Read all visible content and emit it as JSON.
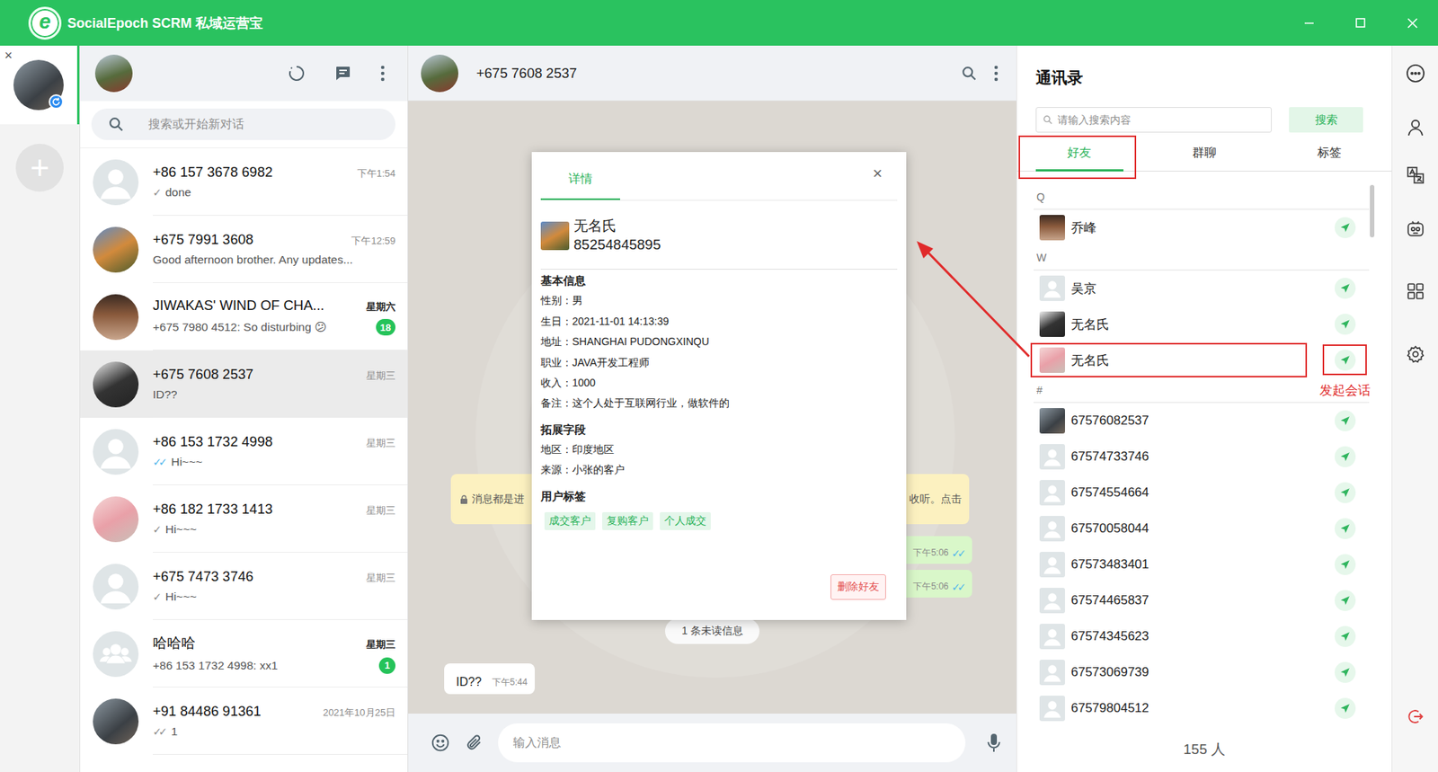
{
  "window": {
    "title": "SocialEpoch SCRM 私域运营宝",
    "logo_letter": "e"
  },
  "accounts": {
    "close": "×",
    "add": "+",
    "items": [
      {
        "selected": true
      }
    ]
  },
  "chat_list": {
    "search_placeholder": "搜索或开始新对话",
    "chats": [
      {
        "name": "+86 157 3678 6982",
        "time": "下午1:54",
        "tick": "✓",
        "tick_read": false,
        "preview": "done",
        "selected": false,
        "avatar": "person"
      },
      {
        "name": "+675 7991 3608",
        "time": "下午12:59",
        "preview": "Good afternoon brother. Any updates...",
        "selected": false,
        "avatar": "photo"
      },
      {
        "name": "JIWAKAS' WIND OF CHA...",
        "time": "星期六",
        "preview": "+675 7980 4512: So disturbing 😕",
        "badge": "18",
        "selected": false,
        "avatar": "photo"
      },
      {
        "name": "+675 7608 2537",
        "time": "星期三",
        "preview": "ID??",
        "selected": true,
        "avatar": "photo"
      },
      {
        "name": "+86 153 1732 4998",
        "time": "星期三",
        "tick": "✓✓",
        "tick_read": true,
        "preview": "Hi~~~",
        "selected": false,
        "avatar": "person"
      },
      {
        "name": "+86 182 1733 1413",
        "time": "星期三",
        "tick": "✓",
        "tick_read": false,
        "preview": "Hi~~~",
        "selected": false,
        "avatar": "photo"
      },
      {
        "name": "+675 7473 3746",
        "time": "星期三",
        "tick": "✓",
        "tick_read": false,
        "preview": "Hi~~~",
        "selected": false,
        "avatar": "person"
      },
      {
        "name": "哈哈哈",
        "time": "星期三",
        "preview": "+86 153 1732 4998: xx1",
        "badge": "1",
        "selected": false,
        "avatar": "group"
      },
      {
        "name": "+91 84486 91361",
        "time": "2021年10月25日",
        "tick": "✓✓",
        "tick_read": false,
        "preview": "1",
        "selected": false,
        "avatar": "photo"
      }
    ]
  },
  "conversation": {
    "name": "+675 7608 2537",
    "input_placeholder": "输入消息",
    "messages": [
      {
        "kind": "system",
        "left": "消息都是进",
        "right": "收听。点击"
      },
      {
        "kind": "out",
        "time": "下午5:06",
        "tick": "✓✓",
        "tick_read": true
      },
      {
        "kind": "out",
        "time": "下午5:06",
        "tick": "✓✓",
        "tick_read": true
      },
      {
        "kind": "unread",
        "text": "1 条未读信息"
      },
      {
        "kind": "in",
        "text": "ID??",
        "time": "下午5:44"
      }
    ]
  },
  "detail": {
    "tabs": [
      {
        "label": "详情",
        "selected": true
      }
    ],
    "close": "×",
    "name": "无名氏",
    "phone": "85254845895",
    "sections": [
      {
        "title": "基本信息",
        "fields": [
          {
            "label": "性别：",
            "value": "男"
          },
          {
            "label": "生日：",
            "value": "2021-11-01 14:13:39"
          },
          {
            "label": "地址：",
            "value": "SHANGHAI PUDONGXINQU"
          },
          {
            "label": "职业：",
            "value": "JAVA开发工程师"
          },
          {
            "label": "收入：",
            "value": "1000"
          },
          {
            "label": "备注：",
            "value": "这个人处于互联网行业，做软件的"
          }
        ]
      },
      {
        "title": "拓展字段",
        "fields": [
          {
            "label": "地区：",
            "value": "印度地区"
          },
          {
            "label": "来源：",
            "value": "小张的客户"
          }
        ]
      }
    ],
    "tags_title": "用户标签",
    "tags": [
      "成交客户",
      "复购客户",
      "个人成交"
    ],
    "delete_button": "删除好友"
  },
  "contacts": {
    "title": "通讯录",
    "search_placeholder": "请输入搜索内容",
    "search_button": "搜索",
    "tabs": [
      {
        "label": "好友",
        "selected": true,
        "annotated": true
      },
      {
        "label": "群聊",
        "selected": false,
        "annotated": false
      },
      {
        "label": "标签",
        "selected": false,
        "annotated": false
      }
    ],
    "groups": [
      {
        "letter": "Q",
        "items": [
          {
            "name": "乔峰",
            "avatar": "photo",
            "annotated": false
          }
        ]
      },
      {
        "letter": "W",
        "items": [
          {
            "name": "吴京",
            "avatar": "person",
            "annotated": false
          },
          {
            "name": "无名氏",
            "avatar": "photo",
            "annotated": false
          },
          {
            "name": "无名氏",
            "avatar": "photo",
            "annotated": true
          }
        ]
      },
      {
        "letter": "#",
        "items": [
          {
            "name": "67576082537",
            "avatar": "photo",
            "annotated": false
          },
          {
            "name": "67574733746",
            "avatar": "person",
            "annotated": false
          },
          {
            "name": "67574554664",
            "avatar": "person",
            "annotated": false
          },
          {
            "name": "67570058044",
            "avatar": "person",
            "annotated": false
          },
          {
            "name": "67573483401",
            "avatar": "person",
            "annotated": false
          },
          {
            "name": "67574465837",
            "avatar": "person",
            "annotated": false
          },
          {
            "name": "67574345623",
            "avatar": "person",
            "annotated": false
          },
          {
            "name": "67573069739",
            "avatar": "person",
            "annotated": false
          },
          {
            "name": "67579804512",
            "avatar": "person",
            "annotated": false
          }
        ]
      }
    ],
    "count": "155 人"
  },
  "annotation": {
    "label": "发起会话"
  }
}
